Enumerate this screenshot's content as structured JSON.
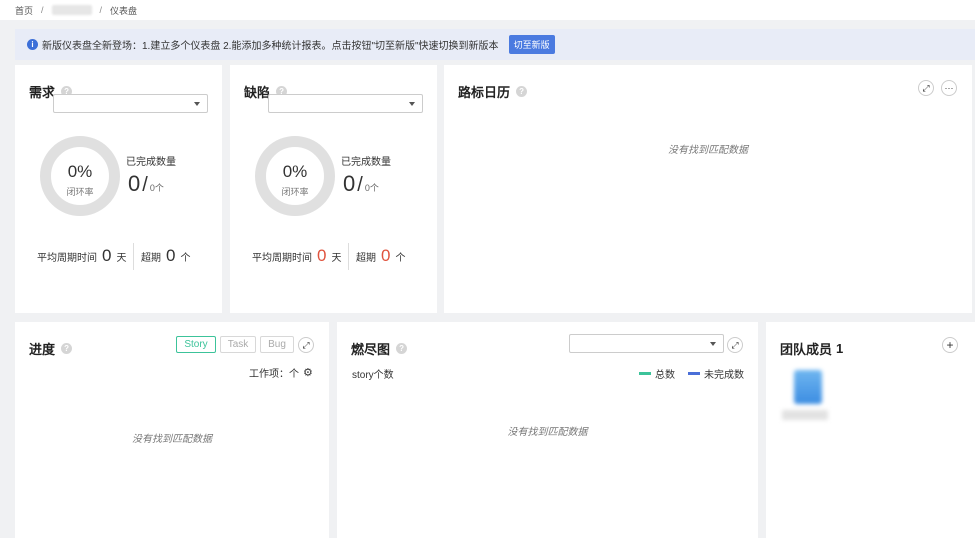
{
  "breadcrumb": {
    "home": "首页",
    "separator": "/",
    "current": "仪表盘"
  },
  "notice": {
    "text": "新版仪表盘全新登场：1.建立多个仪表盘 2.能添加多种统计报表。点击按钮\"切至新版\"快速切换到新版本",
    "button": "切至新版"
  },
  "demand": {
    "title": "需求",
    "percent": "0%",
    "ring_label": "闭环率",
    "done_label": "已完成数量",
    "done_count": "0",
    "slash": "/",
    "total": "0个",
    "avg_label": "平均周期时间",
    "avg_value": "0",
    "avg_unit": "天",
    "overdue_label": "超期",
    "overdue_value": "0",
    "overdue_unit": "个"
  },
  "defect": {
    "title": "缺陷",
    "percent": "0%",
    "ring_label": "闭环率",
    "done_label": "已完成数量",
    "done_count": "0",
    "slash": "/",
    "total": "0个",
    "avg_label": "平均周期时间",
    "avg_value": "0",
    "avg_unit": "天",
    "overdue_label": "超期",
    "overdue_value": "0",
    "overdue_unit": "个"
  },
  "milestone": {
    "title": "路标日历",
    "empty": "没有找到匹配数据"
  },
  "progress": {
    "title": "进度",
    "tabs": [
      "Story",
      "Task",
      "Bug"
    ],
    "work_items": "工作项：个",
    "empty": "没有找到匹配数据"
  },
  "burndown": {
    "title": "燃尽图",
    "y_label": "story个数",
    "legend": [
      {
        "name": "总数",
        "color": "#3cc39a"
      },
      {
        "name": "未完成数",
        "color": "#4a6fd8"
      }
    ],
    "empty": "没有找到匹配数据"
  },
  "team": {
    "title": "团队成员",
    "count": "1",
    "add": "+"
  }
}
